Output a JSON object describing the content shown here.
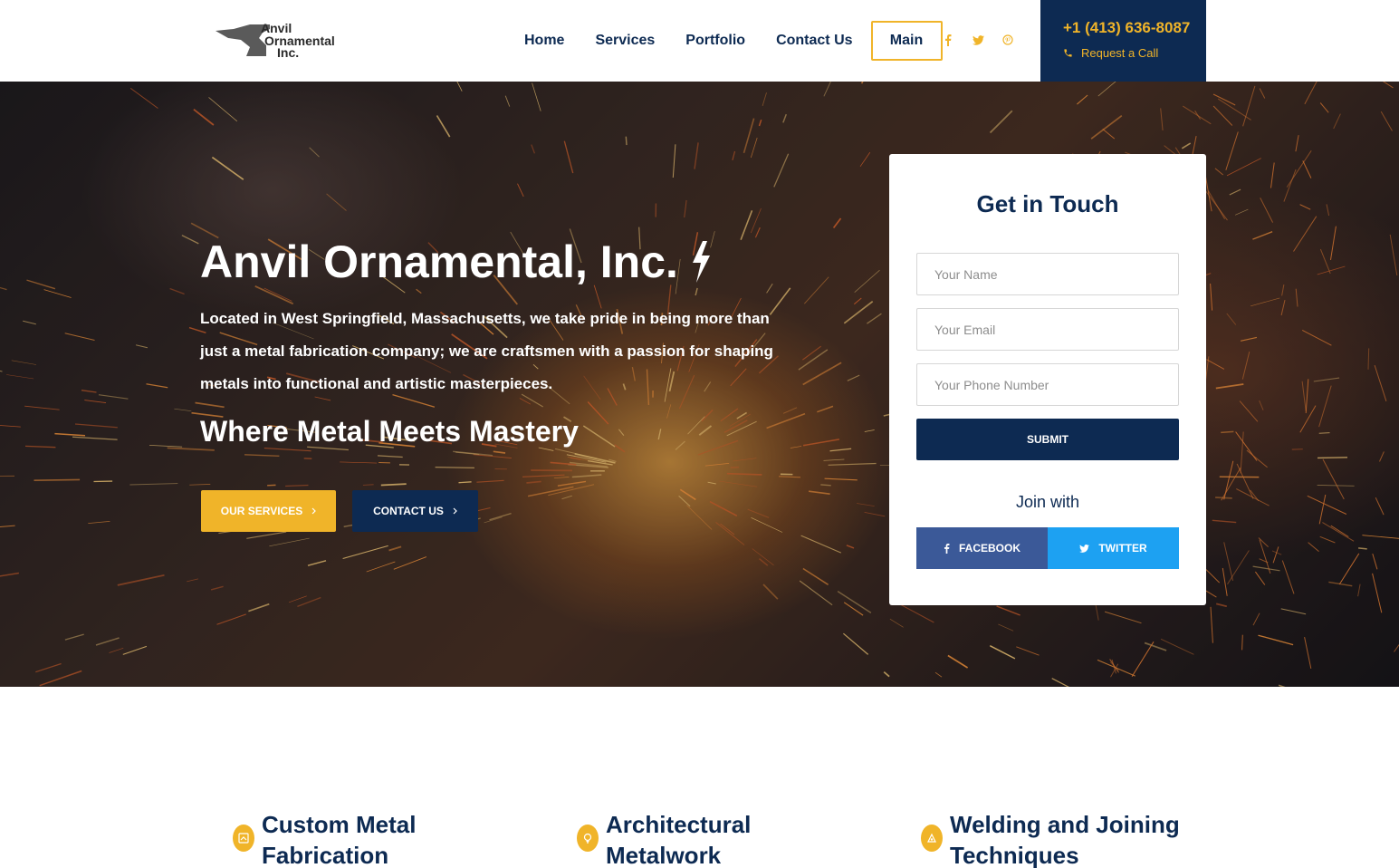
{
  "header": {
    "logo_text": [
      "Anvil",
      "Ornamental",
      "Inc."
    ],
    "nav": {
      "home": "Home",
      "services": "Services",
      "portfolio": "Portfolio",
      "contact": "Contact Us",
      "main": "Main"
    },
    "social_icons": [
      "facebook-icon",
      "twitter-icon",
      "pinterest-icon"
    ],
    "phone": "+1 (413) 636-8087",
    "request_call": "Request a Call"
  },
  "hero": {
    "title": "Anvil Ornamental, Inc.",
    "description": "Located in West Springfield, Massachusetts, we take pride in being more than just a metal fabrication company; we are craftsmen with a passion for shaping metals into functional and artistic masterpieces.",
    "subtitle": "Where Metal Meets Mastery",
    "btn_services": "OUR SERVICES",
    "btn_contact": "CONTACT US"
  },
  "contact_form": {
    "title": "Get in Touch",
    "name_placeholder": "Your Name",
    "email_placeholder": "Your Email",
    "phone_placeholder": "Your Phone Number",
    "submit": "SUBMIT",
    "join_label": "Join with",
    "facebook": "FACEBOOK",
    "twitter": "TWITTER"
  },
  "services": [
    {
      "title": "Custom Metal Fabrication"
    },
    {
      "title": "Architectural Metalwork"
    },
    {
      "title": "Welding and Joining Techniques"
    }
  ],
  "colors": {
    "navy": "#0d2a52",
    "gold": "#f0b429",
    "facebook": "#3b5998",
    "twitter": "#1da1f2"
  }
}
